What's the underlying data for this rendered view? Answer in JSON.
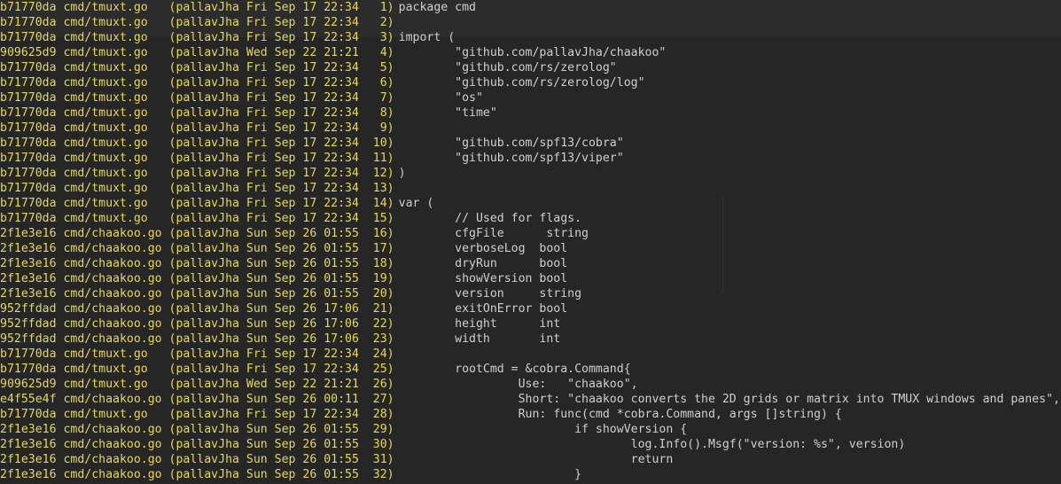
{
  "colors": {
    "background": "#262626",
    "blame_text": "#e6d957",
    "code_text": "#cfcfcf"
  },
  "lines": [
    {
      "blame": "b71770da cmd/tmuxt.go   (pallavJha Fri Sep 17 22:34   1)",
      "code": "package cmd"
    },
    {
      "blame": "b71770da cmd/tmuxt.go   (pallavJha Fri Sep 17 22:34   2)",
      "code": ""
    },
    {
      "blame": "b71770da cmd/tmuxt.go   (pallavJha Fri Sep 17 22:34   3)",
      "code": "import ("
    },
    {
      "blame": "909625d9 cmd/tmuxt.go   (pallavJha Wed Sep 22 21:21   4)",
      "code": "        \"github.com/pallavJha/chaakoo\""
    },
    {
      "blame": "b71770da cmd/tmuxt.go   (pallavJha Fri Sep 17 22:34   5)",
      "code": "        \"github.com/rs/zerolog\""
    },
    {
      "blame": "b71770da cmd/tmuxt.go   (pallavJha Fri Sep 17 22:34   6)",
      "code": "        \"github.com/rs/zerolog/log\""
    },
    {
      "blame": "b71770da cmd/tmuxt.go   (pallavJha Fri Sep 17 22:34   7)",
      "code": "        \"os\""
    },
    {
      "blame": "b71770da cmd/tmuxt.go   (pallavJha Fri Sep 17 22:34   8)",
      "code": "        \"time\""
    },
    {
      "blame": "b71770da cmd/tmuxt.go   (pallavJha Fri Sep 17 22:34   9)",
      "code": ""
    },
    {
      "blame": "b71770da cmd/tmuxt.go   (pallavJha Fri Sep 17 22:34  10)",
      "code": "        \"github.com/spf13/cobra\""
    },
    {
      "blame": "b71770da cmd/tmuxt.go   (pallavJha Fri Sep 17 22:34  11)",
      "code": "        \"github.com/spf13/viper\""
    },
    {
      "blame": "b71770da cmd/tmuxt.go   (pallavJha Fri Sep 17 22:34  12)",
      "code": ")"
    },
    {
      "blame": "b71770da cmd/tmuxt.go   (pallavJha Fri Sep 17 22:34  13)",
      "code": ""
    },
    {
      "blame": "b71770da cmd/tmuxt.go   (pallavJha Fri Sep 17 22:34  14)",
      "code": "var ("
    },
    {
      "blame": "b71770da cmd/tmuxt.go   (pallavJha Fri Sep 17 22:34  15)",
      "code": "        // Used for flags."
    },
    {
      "blame": "2f1e3e16 cmd/chaakoo.go (pallavJha Sun Sep 26 01:55  16)",
      "code": "        cfgFile      string"
    },
    {
      "blame": "2f1e3e16 cmd/chaakoo.go (pallavJha Sun Sep 26 01:55  17)",
      "code": "        verboseLog  bool"
    },
    {
      "blame": "2f1e3e16 cmd/chaakoo.go (pallavJha Sun Sep 26 01:55  18)",
      "code": "        dryRun      bool"
    },
    {
      "blame": "2f1e3e16 cmd/chaakoo.go (pallavJha Sun Sep 26 01:55  19)",
      "code": "        showVersion bool"
    },
    {
      "blame": "2f1e3e16 cmd/chaakoo.go (pallavJha Sun Sep 26 01:55  20)",
      "code": "        version     string"
    },
    {
      "blame": "952ffdad cmd/chaakoo.go (pallavJha Sun Sep 26 17:06  21)",
      "code": "        exitOnError bool"
    },
    {
      "blame": "952ffdad cmd/chaakoo.go (pallavJha Sun Sep 26 17:06  22)",
      "code": "        height      int"
    },
    {
      "blame": "952ffdad cmd/chaakoo.go (pallavJha Sun Sep 26 17:06  23)",
      "code": "        width       int"
    },
    {
      "blame": "b71770da cmd/tmuxt.go   (pallavJha Fri Sep 17 22:34  24)",
      "code": ""
    },
    {
      "blame": "b71770da cmd/tmuxt.go   (pallavJha Fri Sep 17 22:34  25)",
      "code": "        rootCmd = &cobra.Command{"
    },
    {
      "blame": "909625d9 cmd/tmuxt.go   (pallavJha Wed Sep 22 21:21  26)",
      "code": "                 Use:   \"chaakoo\","
    },
    {
      "blame": "e4f55e4f cmd/chaakoo.go (pallavJha Sun Sep 26 00:11  27)",
      "code": "                 Short: \"chaakoo converts the 2D grids or matrix into TMUX windows and panes\","
    },
    {
      "blame": "b71770da cmd/tmuxt.go   (pallavJha Fri Sep 17 22:34  28)",
      "code": "                 Run: func(cmd *cobra.Command, args []string) {"
    },
    {
      "blame": "2f1e3e16 cmd/chaakoo.go (pallavJha Sun Sep 26 01:55  29)",
      "code": "                         if showVersion {"
    },
    {
      "blame": "2f1e3e16 cmd/chaakoo.go (pallavJha Sun Sep 26 01:55  30)",
      "code": "                                 log.Info().Msgf(\"version: %s\", version)"
    },
    {
      "blame": "2f1e3e16 cmd/chaakoo.go (pallavJha Sun Sep 26 01:55  31)",
      "code": "                                 return"
    },
    {
      "blame": "2f1e3e16 cmd/chaakoo.go (pallavJha Sun Sep 26 01:55  32)",
      "code": "                         }"
    }
  ]
}
